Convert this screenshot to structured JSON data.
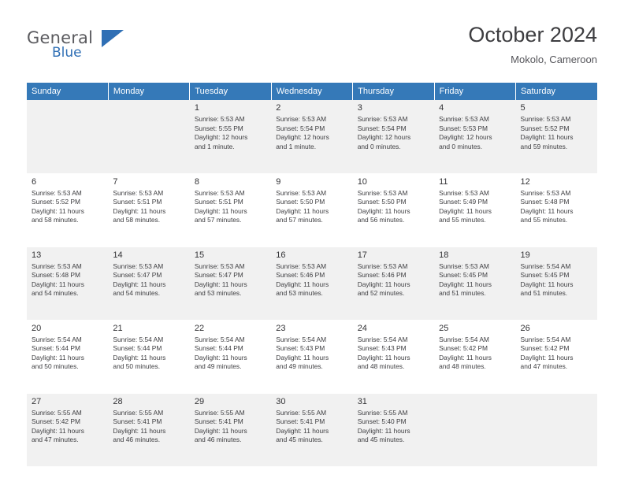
{
  "brand": {
    "name_line1": "General",
    "name_line2": "Blue",
    "accent_color": "#2f6fb5"
  },
  "header": {
    "title": "October 2024",
    "location": "Mokolo, Cameroon"
  },
  "calendar": {
    "weekday_headers": [
      "Sunday",
      "Monday",
      "Tuesday",
      "Wednesday",
      "Thursday",
      "Friday",
      "Saturday"
    ],
    "header_bg": "#3579b8",
    "weeks": [
      [
        {
          "day": "",
          "lines": []
        },
        {
          "day": "",
          "lines": []
        },
        {
          "day": "1",
          "lines": [
            "Sunrise: 5:53 AM",
            "Sunset: 5:55 PM",
            "Daylight: 12 hours",
            "and 1 minute."
          ]
        },
        {
          "day": "2",
          "lines": [
            "Sunrise: 5:53 AM",
            "Sunset: 5:54 PM",
            "Daylight: 12 hours",
            "and 1 minute."
          ]
        },
        {
          "day": "3",
          "lines": [
            "Sunrise: 5:53 AM",
            "Sunset: 5:54 PM",
            "Daylight: 12 hours",
            "and 0 minutes."
          ]
        },
        {
          "day": "4",
          "lines": [
            "Sunrise: 5:53 AM",
            "Sunset: 5:53 PM",
            "Daylight: 12 hours",
            "and 0 minutes."
          ]
        },
        {
          "day": "5",
          "lines": [
            "Sunrise: 5:53 AM",
            "Sunset: 5:52 PM",
            "Daylight: 11 hours",
            "and 59 minutes."
          ]
        }
      ],
      [
        {
          "day": "6",
          "lines": [
            "Sunrise: 5:53 AM",
            "Sunset: 5:52 PM",
            "Daylight: 11 hours",
            "and 58 minutes."
          ]
        },
        {
          "day": "7",
          "lines": [
            "Sunrise: 5:53 AM",
            "Sunset: 5:51 PM",
            "Daylight: 11 hours",
            "and 58 minutes."
          ]
        },
        {
          "day": "8",
          "lines": [
            "Sunrise: 5:53 AM",
            "Sunset: 5:51 PM",
            "Daylight: 11 hours",
            "and 57 minutes."
          ]
        },
        {
          "day": "9",
          "lines": [
            "Sunrise: 5:53 AM",
            "Sunset: 5:50 PM",
            "Daylight: 11 hours",
            "and 57 minutes."
          ]
        },
        {
          "day": "10",
          "lines": [
            "Sunrise: 5:53 AM",
            "Sunset: 5:50 PM",
            "Daylight: 11 hours",
            "and 56 minutes."
          ]
        },
        {
          "day": "11",
          "lines": [
            "Sunrise: 5:53 AM",
            "Sunset: 5:49 PM",
            "Daylight: 11 hours",
            "and 55 minutes."
          ]
        },
        {
          "day": "12",
          "lines": [
            "Sunrise: 5:53 AM",
            "Sunset: 5:48 PM",
            "Daylight: 11 hours",
            "and 55 minutes."
          ]
        }
      ],
      [
        {
          "day": "13",
          "lines": [
            "Sunrise: 5:53 AM",
            "Sunset: 5:48 PM",
            "Daylight: 11 hours",
            "and 54 minutes."
          ]
        },
        {
          "day": "14",
          "lines": [
            "Sunrise: 5:53 AM",
            "Sunset: 5:47 PM",
            "Daylight: 11 hours",
            "and 54 minutes."
          ]
        },
        {
          "day": "15",
          "lines": [
            "Sunrise: 5:53 AM",
            "Sunset: 5:47 PM",
            "Daylight: 11 hours",
            "and 53 minutes."
          ]
        },
        {
          "day": "16",
          "lines": [
            "Sunrise: 5:53 AM",
            "Sunset: 5:46 PM",
            "Daylight: 11 hours",
            "and 53 minutes."
          ]
        },
        {
          "day": "17",
          "lines": [
            "Sunrise: 5:53 AM",
            "Sunset: 5:46 PM",
            "Daylight: 11 hours",
            "and 52 minutes."
          ]
        },
        {
          "day": "18",
          "lines": [
            "Sunrise: 5:53 AM",
            "Sunset: 5:45 PM",
            "Daylight: 11 hours",
            "and 51 minutes."
          ]
        },
        {
          "day": "19",
          "lines": [
            "Sunrise: 5:54 AM",
            "Sunset: 5:45 PM",
            "Daylight: 11 hours",
            "and 51 minutes."
          ]
        }
      ],
      [
        {
          "day": "20",
          "lines": [
            "Sunrise: 5:54 AM",
            "Sunset: 5:44 PM",
            "Daylight: 11 hours",
            "and 50 minutes."
          ]
        },
        {
          "day": "21",
          "lines": [
            "Sunrise: 5:54 AM",
            "Sunset: 5:44 PM",
            "Daylight: 11 hours",
            "and 50 minutes."
          ]
        },
        {
          "day": "22",
          "lines": [
            "Sunrise: 5:54 AM",
            "Sunset: 5:44 PM",
            "Daylight: 11 hours",
            "and 49 minutes."
          ]
        },
        {
          "day": "23",
          "lines": [
            "Sunrise: 5:54 AM",
            "Sunset: 5:43 PM",
            "Daylight: 11 hours",
            "and 49 minutes."
          ]
        },
        {
          "day": "24",
          "lines": [
            "Sunrise: 5:54 AM",
            "Sunset: 5:43 PM",
            "Daylight: 11 hours",
            "and 48 minutes."
          ]
        },
        {
          "day": "25",
          "lines": [
            "Sunrise: 5:54 AM",
            "Sunset: 5:42 PM",
            "Daylight: 11 hours",
            "and 48 minutes."
          ]
        },
        {
          "day": "26",
          "lines": [
            "Sunrise: 5:54 AM",
            "Sunset: 5:42 PM",
            "Daylight: 11 hours",
            "and 47 minutes."
          ]
        }
      ],
      [
        {
          "day": "27",
          "lines": [
            "Sunrise: 5:55 AM",
            "Sunset: 5:42 PM",
            "Daylight: 11 hours",
            "and 47 minutes."
          ]
        },
        {
          "day": "28",
          "lines": [
            "Sunrise: 5:55 AM",
            "Sunset: 5:41 PM",
            "Daylight: 11 hours",
            "and 46 minutes."
          ]
        },
        {
          "day": "29",
          "lines": [
            "Sunrise: 5:55 AM",
            "Sunset: 5:41 PM",
            "Daylight: 11 hours",
            "and 46 minutes."
          ]
        },
        {
          "day": "30",
          "lines": [
            "Sunrise: 5:55 AM",
            "Sunset: 5:41 PM",
            "Daylight: 11 hours",
            "and 45 minutes."
          ]
        },
        {
          "day": "31",
          "lines": [
            "Sunrise: 5:55 AM",
            "Sunset: 5:40 PM",
            "Daylight: 11 hours",
            "and 45 minutes."
          ]
        },
        {
          "day": "",
          "lines": []
        },
        {
          "day": "",
          "lines": []
        }
      ]
    ]
  }
}
